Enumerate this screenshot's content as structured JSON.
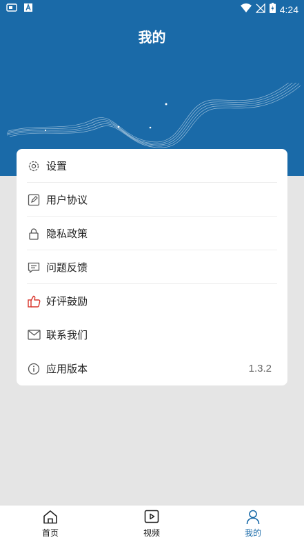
{
  "status_bar": {
    "time": "4:24"
  },
  "header": {
    "title": "我的"
  },
  "menu": {
    "items": [
      {
        "label": "设置",
        "icon": "gear-icon"
      },
      {
        "label": "用户协议",
        "icon": "edit-icon"
      },
      {
        "label": "隐私政策",
        "icon": "lock-icon"
      },
      {
        "label": "问题反馈",
        "icon": "message-icon"
      },
      {
        "label": "好评鼓励",
        "icon": "thumbs-up-icon",
        "color": "#d9352c"
      },
      {
        "label": "联系我们",
        "icon": "mail-icon"
      },
      {
        "label": "应用版本",
        "icon": "info-icon",
        "value": "1.3.2"
      }
    ]
  },
  "tabbar": {
    "tabs": [
      {
        "label": "首页",
        "icon": "home-icon"
      },
      {
        "label": "视频",
        "icon": "video-icon"
      },
      {
        "label": "我的",
        "icon": "user-icon",
        "active": true
      }
    ]
  },
  "colors": {
    "primary": "#1a6aa8",
    "background": "#e5e5e5",
    "like": "#d9352c"
  }
}
